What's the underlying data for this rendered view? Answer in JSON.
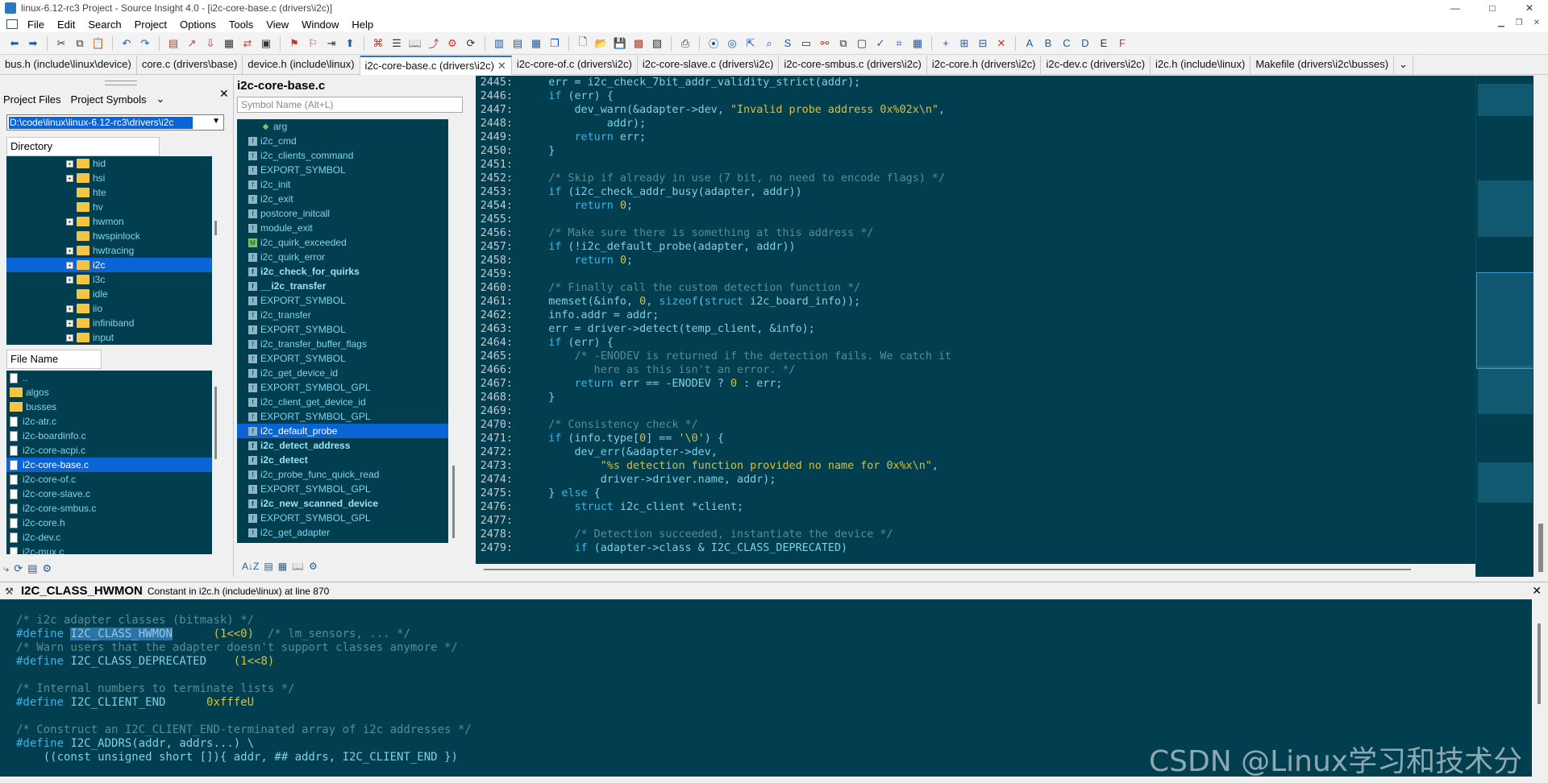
{
  "window": {
    "title": "linux-6.12-rc3 Project - Source Insight 4.0 - [i2c-core-base.c (drivers\\i2c)]",
    "min": "—",
    "max": "□",
    "close": "✕"
  },
  "menu": [
    "File",
    "Edit",
    "Search",
    "Project",
    "Options",
    "Tools",
    "View",
    "Window",
    "Help"
  ],
  "tabs": [
    {
      "label": "bus.h (include\\linux\\device)"
    },
    {
      "label": "core.c (drivers\\base)"
    },
    {
      "label": "device.h (include\\linux)"
    },
    {
      "label": "i2c-core-base.c (drivers\\i2c)",
      "active": true
    },
    {
      "label": "i2c-core-of.c (drivers\\i2c)"
    },
    {
      "label": "i2c-core-slave.c (drivers\\i2c)"
    },
    {
      "label": "i2c-core-smbus.c (drivers\\i2c)"
    },
    {
      "label": "i2c-core.h (drivers\\i2c)"
    },
    {
      "label": "i2c-dev.c (drivers\\i2c)"
    },
    {
      "label": "i2c.h (include\\linux)"
    },
    {
      "label": "Makefile (drivers\\i2c\\busses)"
    }
  ],
  "tab_close": "✕",
  "tab_overflow": "⌄",
  "left": {
    "tab_project_files": "Project Files",
    "tab_project_symbols": "Project Symbols",
    "tab_menu": "⌄",
    "close": "✕",
    "path": "D:\\code\\linux\\linux-6.12-rc3\\drivers\\i2c",
    "directory_header": "Directory",
    "dirs": [
      {
        "name": "hid",
        "plus": true
      },
      {
        "name": "hsi",
        "plus": true
      },
      {
        "name": "hte",
        "plus": false
      },
      {
        "name": "hv",
        "plus": false
      },
      {
        "name": "hwmon",
        "plus": true
      },
      {
        "name": "hwspinlock",
        "plus": false
      },
      {
        "name": "hwtracing",
        "plus": true
      },
      {
        "name": "i2c",
        "plus": true,
        "selected": true
      },
      {
        "name": "i3c",
        "plus": true
      },
      {
        "name": "idle",
        "plus": false
      },
      {
        "name": "iio",
        "plus": true
      },
      {
        "name": "infiniband",
        "plus": true
      },
      {
        "name": "input",
        "plus": true
      }
    ],
    "filename_header": "File Name",
    "files": [
      {
        "name": "..",
        "type": "file"
      },
      {
        "name": "algos",
        "type": "folder"
      },
      {
        "name": "busses",
        "type": "folder"
      },
      {
        "name": "i2c-atr.c",
        "type": "file"
      },
      {
        "name": "i2c-boardinfo.c",
        "type": "file"
      },
      {
        "name": "i2c-core-acpi.c",
        "type": "file"
      },
      {
        "name": "i2c-core-base.c",
        "type": "file",
        "selected": true
      },
      {
        "name": "i2c-core-of.c",
        "type": "file"
      },
      {
        "name": "i2c-core-slave.c",
        "type": "file"
      },
      {
        "name": "i2c-core-smbus.c",
        "type": "file"
      },
      {
        "name": "i2c-core.h",
        "type": "file"
      },
      {
        "name": "i2c-dev.c",
        "type": "file"
      },
      {
        "name": "i2c-mux.c",
        "type": "file"
      }
    ]
  },
  "symbols": {
    "title": "i2c-core-base.c",
    "search_placeholder": "Symbol Name (Alt+L)",
    "items": [
      {
        "name": "arg",
        "kind": "arrow"
      },
      {
        "name": "i2c_cmd"
      },
      {
        "name": "i2c_clients_command"
      },
      {
        "name": "EXPORT_SYMBOL"
      },
      {
        "name": "i2c_init"
      },
      {
        "name": "i2c_exit"
      },
      {
        "name": "postcore_initcall"
      },
      {
        "name": "module_exit"
      },
      {
        "name": "i2c_quirk_exceeded",
        "kind": "macro"
      },
      {
        "name": "i2c_quirk_error"
      },
      {
        "name": "i2c_check_for_quirks",
        "bold": true
      },
      {
        "name": "__i2c_transfer",
        "bold": true
      },
      {
        "name": "EXPORT_SYMBOL"
      },
      {
        "name": "i2c_transfer"
      },
      {
        "name": "EXPORT_SYMBOL"
      },
      {
        "name": "i2c_transfer_buffer_flags"
      },
      {
        "name": "EXPORT_SYMBOL"
      },
      {
        "name": "i2c_get_device_id"
      },
      {
        "name": "EXPORT_SYMBOL_GPL"
      },
      {
        "name": "i2c_client_get_device_id"
      },
      {
        "name": "EXPORT_SYMBOL_GPL"
      },
      {
        "name": "i2c_default_probe",
        "selected": true
      },
      {
        "name": "i2c_detect_address",
        "bold": true
      },
      {
        "name": "i2c_detect",
        "bold": true
      },
      {
        "name": "i2c_probe_func_quick_read"
      },
      {
        "name": "EXPORT_SYMBOL_GPL"
      },
      {
        "name": "i2c_new_scanned_device",
        "bold": true
      },
      {
        "name": "EXPORT_SYMBOL_GPL"
      },
      {
        "name": "i2c_get_adapter"
      }
    ]
  },
  "editor": {
    "lines": [
      {
        "n": "2445:",
        "html": "    err = i2c_check_7bit_addr_validity_strict(addr);"
      },
      {
        "n": "2446:",
        "html": "    <span class=\"kw\">if</span> (err) {"
      },
      {
        "n": "2447:",
        "html": "        dev_warn(&amp;adapter-&gt;dev, <span class=\"str\">\"Invalid probe address 0x%02x\\n\"</span>,"
      },
      {
        "n": "2448:",
        "html": "             addr);"
      },
      {
        "n": "2449:",
        "html": "        <span class=\"kw\">return</span> err;"
      },
      {
        "n": "2450:",
        "html": "    }"
      },
      {
        "n": "2451:",
        "html": ""
      },
      {
        "n": "2452:",
        "html": "    <span class=\"cm\">/* Skip if already in use (7 bit, no need to encode flags) */</span>"
      },
      {
        "n": "2453:",
        "html": "    <span class=\"kw\">if</span> (i2c_check_addr_busy(adapter, addr))"
      },
      {
        "n": "2454:",
        "html": "        <span class=\"kw\">return</span> <span class=\"num\">0</span>;"
      },
      {
        "n": "2455:",
        "html": ""
      },
      {
        "n": "2456:",
        "html": "    <span class=\"cm\">/* Make sure there is something at this address */</span>"
      },
      {
        "n": "2457:",
        "html": "    <span class=\"kw\">if</span> (!i2c_default_probe(adapter, addr))"
      },
      {
        "n": "2458:",
        "html": "        <span class=\"kw\">return</span> <span class=\"num\">0</span>;"
      },
      {
        "n": "2459:",
        "html": ""
      },
      {
        "n": "2460:",
        "html": "    <span class=\"cm\">/* Finally call the custom detection function */</span>"
      },
      {
        "n": "2461:",
        "html": "    memset(&amp;info, <span class=\"num\">0</span>, <span class=\"kw\">sizeof</span>(<span class=\"kw\">struct</span> i2c_board_info));"
      },
      {
        "n": "2462:",
        "html": "    info.addr = addr;"
      },
      {
        "n": "2463:",
        "html": "    err = driver-&gt;detect(temp_client, &amp;info);"
      },
      {
        "n": "2464:",
        "html": "    <span class=\"kw\">if</span> (err) {"
      },
      {
        "n": "2465:",
        "html": "        <span class=\"cm\">/* -ENODEV is returned if the detection fails. We catch it</span>"
      },
      {
        "n": "2466:",
        "html": "<span class=\"cm\">           here as this isn't an error. */</span>"
      },
      {
        "n": "2467:",
        "html": "        <span class=\"kw\">return</span> err == -ENODEV ? <span class=\"num\">0</span> : err;"
      },
      {
        "n": "2468:",
        "html": "    }"
      },
      {
        "n": "2469:",
        "html": ""
      },
      {
        "n": "2470:",
        "html": "    <span class=\"cm\">/* Consistency check */</span>"
      },
      {
        "n": "2471:",
        "html": "    <span class=\"kw\">if</span> (info.type[<span class=\"num\">0</span>] == <span class=\"str\">'\\0'</span>) {"
      },
      {
        "n": "2472:",
        "html": "        dev_err(&amp;adapter-&gt;dev,"
      },
      {
        "n": "2473:",
        "html": "            <span class=\"str\">\"%s detection function provided no name for 0x%x\\n\"</span>,"
      },
      {
        "n": "2474:",
        "html": "            driver-&gt;driver.name, addr);"
      },
      {
        "n": "2475:",
        "html": "    } <span class=\"kw\">else</span> {"
      },
      {
        "n": "2476:",
        "html": "        <span class=\"kw\">struct</span> i2c_client *client;"
      },
      {
        "n": "2477:",
        "html": ""
      },
      {
        "n": "2478:",
        "html": "        <span class=\"cm\">/* Detection succeeded, instantiate the device */</span>"
      },
      {
        "n": "2479:",
        "html": "        <span class=\"kw\">if</span> (adapter-&gt;class &amp; I2C_CLASS_DEPRECATED)"
      }
    ]
  },
  "context": {
    "symbol": "I2C_CLASS_HWMON",
    "info": "Constant in i2c.h (include\\linux) at line 870",
    "close": "✕",
    "lines": [
      "<span class=\"cm\">/* i2c adapter classes (bitmask) */</span>",
      "<span class=\"pp\">#define</span> <span class=\"hl\">I2C_CLASS_HWMON</span>      <span class=\"num\">(1&lt;&lt;0)</span>  <span class=\"cm\">/* lm_sensors, ... */</span>",
      "<span class=\"cm\">/* Warn users that the adapter doesn't support classes anymore */</span>",
      "<span class=\"pp\">#define</span> <span class=\"id\">I2C_CLASS_DEPRECATED</span>    <span class=\"num\">(1&lt;&lt;8)</span>",
      "",
      "<span class=\"cm\">/* Internal numbers to terminate lists */</span>",
      "<span class=\"pp\">#define</span> <span class=\"id\">I2C_CLIENT_END</span>      <span class=\"num\">0xfffeU</span>",
      "",
      "<span class=\"cm\">/* Construct an I2C_CLIENT_END-terminated array of i2c addresses */</span>",
      "<span class=\"pp\">#define</span> <span class=\"id\">I2C_ADDRS(addr, addrs...) \\</span>",
      "<span class=\"id\">    ((const unsigned short []){ addr, ## addrs, I2C_CLIENT_END })</span>"
    ]
  },
  "watermark": "CSDN @Linux学习和技术分享"
}
